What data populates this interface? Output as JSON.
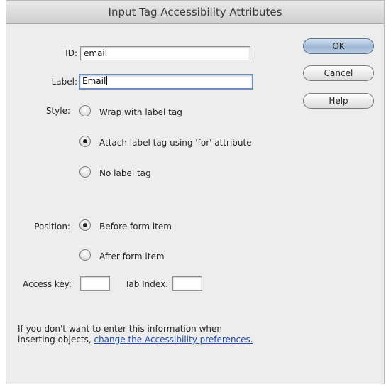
{
  "dialog": {
    "title": "Input Tag Accessibility Attributes"
  },
  "form": {
    "id_label": "ID:",
    "id_value": "email",
    "label_label": "Label:",
    "label_value": "Email",
    "style_label": "Style:",
    "style_options": [
      {
        "label": "Wrap with label tag",
        "selected": false
      },
      {
        "label": "Attach label tag using 'for' attribute",
        "selected": true
      },
      {
        "label": "No label tag",
        "selected": false
      }
    ],
    "position_label": "Position:",
    "position_options": [
      {
        "label": "Before form item",
        "selected": true
      },
      {
        "label": "After form item",
        "selected": false
      }
    ],
    "access_key_label": "Access key:",
    "access_key_value": "",
    "tab_index_label": "Tab Index:",
    "tab_index_value": ""
  },
  "buttons": {
    "ok": "OK",
    "cancel": "Cancel",
    "help": "Help"
  },
  "footer": {
    "line1": "If you don't want to enter this information when",
    "line2_prefix": "inserting objects,",
    "link_text": "change the Accessibility preferences."
  }
}
